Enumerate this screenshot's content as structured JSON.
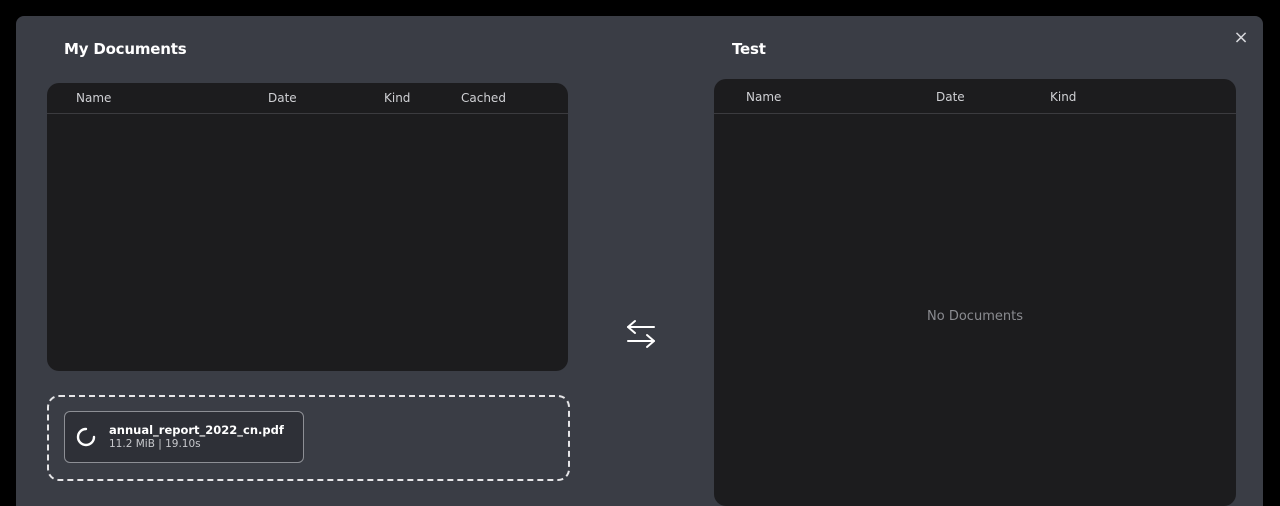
{
  "modal": {
    "close_label": "×"
  },
  "left_panel": {
    "title": "My Documents",
    "columns": [
      "Name",
      "Date",
      "Kind",
      "Cached"
    ]
  },
  "right_panel": {
    "title": "Test",
    "columns": [
      "Name",
      "Date",
      "Kind"
    ],
    "empty_message": "No Documents"
  },
  "upload": {
    "file_name": "annual_report_2022_cn.pdf",
    "file_meta": "11.2 MiB | 19.10s"
  },
  "icons": {
    "close": "close-icon",
    "swap": "swap-arrows-icon",
    "spinner": "loading-spinner-icon"
  },
  "colors": {
    "modal_bg": "#3a3d45",
    "table_bg": "#1c1c1e",
    "text_primary": "#ffffff",
    "text_muted": "#8a8b90"
  }
}
